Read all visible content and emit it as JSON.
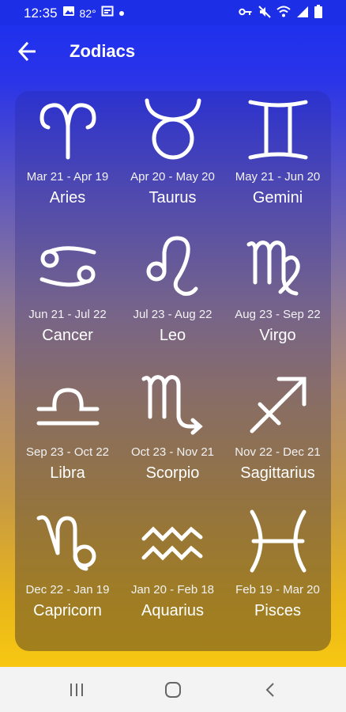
{
  "status_bar": {
    "time": "12:35",
    "temperature": "82°",
    "icons": [
      "image-icon",
      "weather-icon",
      "calendar-icon",
      "dot-icon",
      "key-icon",
      "mute-icon",
      "wifi-icon",
      "signal-icon",
      "battery-icon"
    ]
  },
  "app_bar": {
    "title": "Zodiacs",
    "back_icon": "arrow-left-icon"
  },
  "zodiacs": [
    {
      "name": "Aries",
      "dates": "Mar 21 - Apr 19",
      "icon": "aries-icon"
    },
    {
      "name": "Taurus",
      "dates": "Apr 20 - May 20",
      "icon": "taurus-icon"
    },
    {
      "name": "Gemini",
      "dates": "May 21 - Jun 20",
      "icon": "gemini-icon"
    },
    {
      "name": "Cancer",
      "dates": "Jun 21 - Jul 22",
      "icon": "cancer-icon"
    },
    {
      "name": "Leo",
      "dates": "Jul 23 - Aug 22",
      "icon": "leo-icon"
    },
    {
      "name": "Virgo",
      "dates": "Aug 23 - Sep 22",
      "icon": "virgo-icon"
    },
    {
      "name": "Libra",
      "dates": "Sep 23 - Oct 22",
      "icon": "libra-icon"
    },
    {
      "name": "Scorpio",
      "dates": "Oct 23 - Nov 21",
      "icon": "scorpio-icon"
    },
    {
      "name": "Sagittarius",
      "dates": "Nov 22 - Dec 21",
      "icon": "sagittarius-icon"
    },
    {
      "name": "Capricorn",
      "dates": "Dec 22 - Jan 19",
      "icon": "capricorn-icon"
    },
    {
      "name": "Aquarius",
      "dates": "Jan 20 - Feb 18",
      "icon": "aquarius-icon"
    },
    {
      "name": "Pisces",
      "dates": "Feb 19 - Mar 20",
      "icon": "pisces-icon"
    }
  ],
  "nav_bar": {
    "icons": [
      "recent-apps-icon",
      "home-icon",
      "back-icon"
    ]
  },
  "colors": {
    "status_bar": "#1d2fe6",
    "gradient_top": "#1a2ff0",
    "gradient_bottom": "#f7c712",
    "text": "#ffffff",
    "nav_bar": "#f3f3f3"
  }
}
